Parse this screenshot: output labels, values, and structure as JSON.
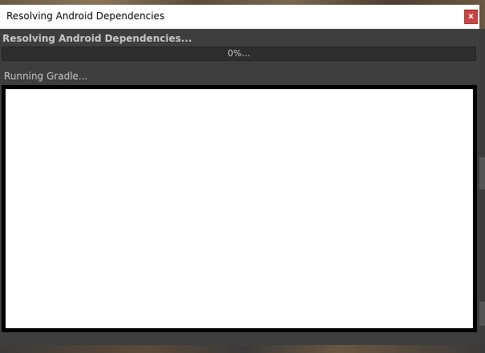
{
  "window": {
    "title": "Resolving Android Dependencies",
    "close_label": "x"
  },
  "dialog": {
    "header": "Resolving Android Dependencies...",
    "progress_percent": 0,
    "progress_text": "0%...",
    "status": "Running Gradle...",
    "output": ""
  },
  "colors": {
    "dialog_bg": "#3e3e3e",
    "close_button": "#c94545",
    "text": "#c8c8c8"
  }
}
